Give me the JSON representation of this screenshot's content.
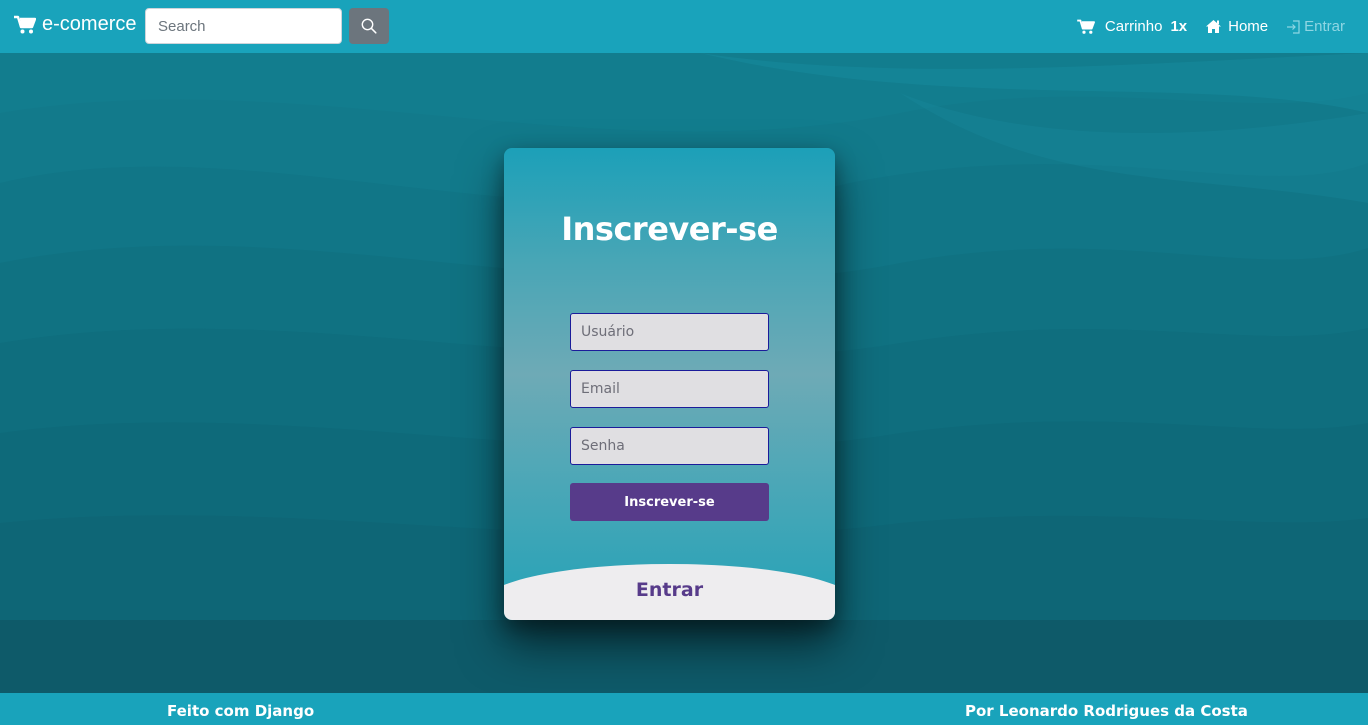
{
  "navbar": {
    "brand": "e-comerce",
    "search_placeholder": "Search",
    "cart_label": "Carrinho",
    "cart_count": "1x",
    "home_label": "Home",
    "login_label": "Entrar"
  },
  "card": {
    "title": "Inscrever-se",
    "username_placeholder": "Usuário",
    "email_placeholder": "Email",
    "password_placeholder": "Senha",
    "submit_label": "Inscrever-se",
    "login_label": "Entrar"
  },
  "footer": {
    "left": "Feito com Django",
    "right": "Por Leonardo Rodrigues da Costa"
  },
  "colors": {
    "navbar": "#19a3bb",
    "accent_purple": "#573b8a",
    "search_button": "#6c757d"
  },
  "icons": [
    "cart-icon",
    "search-icon",
    "home-icon",
    "login-icon"
  ]
}
